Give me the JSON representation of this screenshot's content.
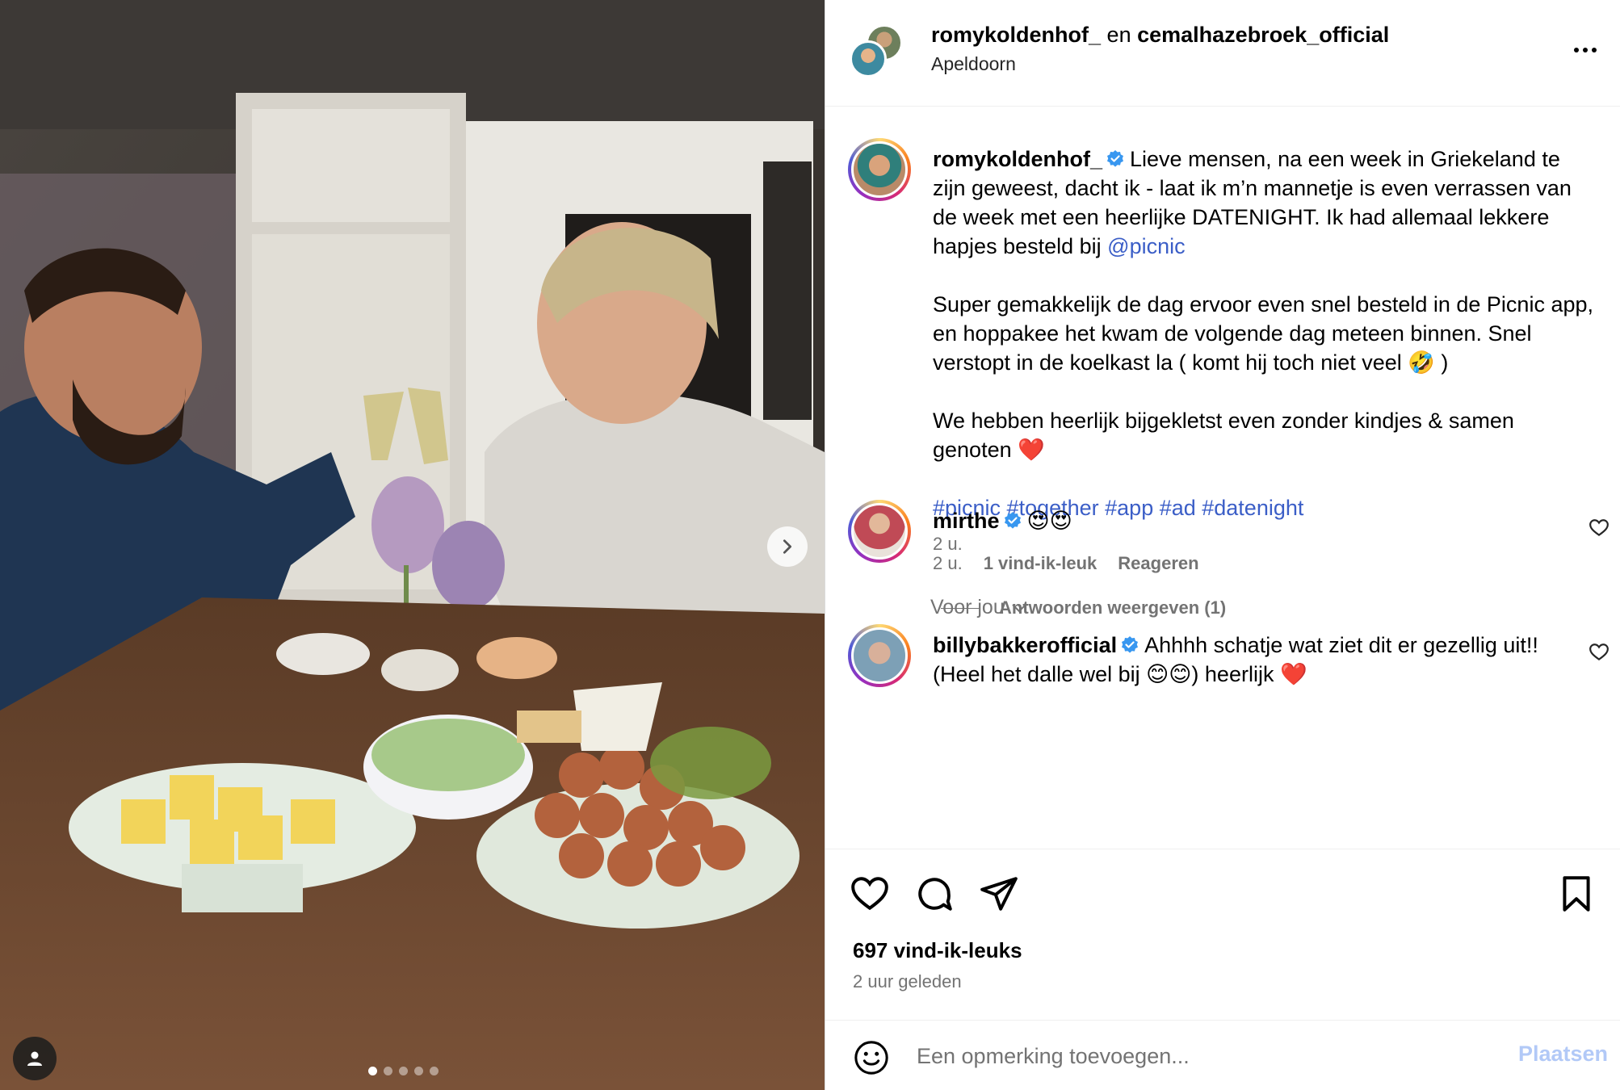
{
  "colors": {
    "link": "#3b5ec7",
    "verified": "#3897f0",
    "muted": "#737373",
    "post_button": "#b2c9f7"
  },
  "header": {
    "user1": "romykoldenhof_",
    "connector": "en",
    "user2": "cemalhazebroek_official",
    "location": "Apeldoorn"
  },
  "caption": {
    "username": "romykoldenhof_",
    "text_1": "Lieve mensen, na een week in Griekeland te zijn geweest, dacht ik - laat ik m’n mannetje is even verrassen van de week met een heerlijke DATENIGHT. Ik had allemaal lekkere hapjes besteld bij ",
    "mention": "@picnic",
    "text_2": "\n\nSuper gemakkelijk de dag ervoor even snel besteld in de Picnic app, en hoppakee het kwam de volgende dag meteen binnen. Snel verstopt in de koelkast la ( komt hij toch niet veel 🤣 )\n\nWe hebben heerlijk bijgekletst even zonder kindjes & samen genoten ❤️\n\n",
    "hashtags": "#picnic #together #app #ad #datenight",
    "time": "2 u."
  },
  "section_label": "Voor jou",
  "comments": [
    {
      "username": "mirthe",
      "text": "😍😍",
      "time": "2 u.",
      "likes": "1 vind-ik-leuk",
      "reply": "Reageren",
      "view_replies": "Antwoorden weergeven (1)"
    },
    {
      "username": "billybakkerofficial",
      "text": "Ahhhh schatje wat ziet dit er gezellig uit!! (Heel het dalle wel bij 😊😊) heerlijk ❤️"
    }
  ],
  "footer": {
    "likes": "697 vind-ik-leuks",
    "ago": "2 uur geleden",
    "comment_placeholder": "Een opmerking toevoegen...",
    "post_label": "Plaatsen"
  },
  "icons": {
    "more": "more-icon",
    "like": "heart-icon",
    "comment": "comment-icon",
    "share": "send-icon",
    "save": "bookmark-icon",
    "emoji": "emoji-icon",
    "next": "chevron-right-icon",
    "tag": "user-tag-icon"
  },
  "carousel": {
    "slides": 5,
    "active": 1
  }
}
